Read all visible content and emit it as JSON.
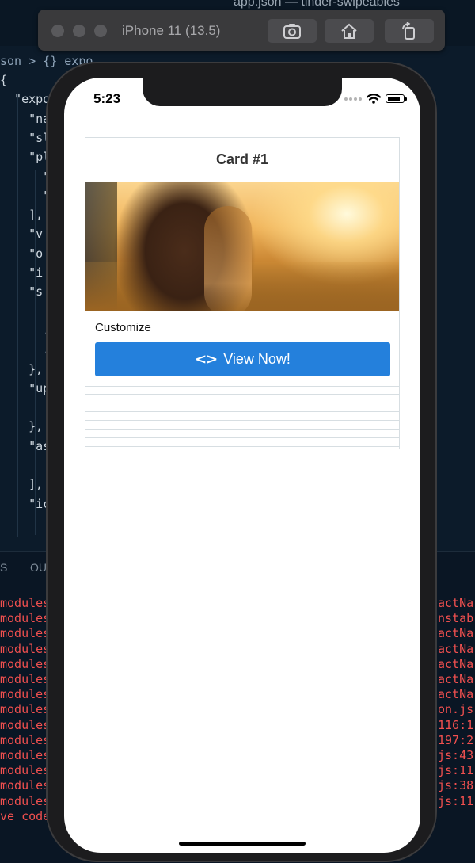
{
  "editor": {
    "title": "app.json — tinder-swipeables",
    "breadcrumb": "son > {} expo",
    "code_lines": [
      "{",
      "  \"expo",
      "    \"na",
      "    \"sl",
      "    \"pl",
      "      \"",
      "      \"",
      "    ],",
      "    \"v",
      "    \"o",
      "    \"i",
      "    \"s",
      "      '",
      "      .",
      "      .",
      "    },",
      "    \"up",
      "      '",
      "    },",
      "    \"as",
      "      '",
      "    ],",
      "    \"ic"
    ]
  },
  "terminal": {
    "tab_left": "S",
    "tab_output": "OU",
    "left_lines": [
      "modules",
      "modules",
      "modules",
      "modules",
      "modules",
      "modules",
      "modules",
      "modules",
      "modules",
      "modules",
      "modules",
      "modules",
      "modules",
      "modules",
      "ve code"
    ],
    "right_lines": [
      "actNa",
      "nstab",
      "actNa",
      "actNa",
      "actNa",
      "actNa",
      "actNa",
      "on.js",
      "116:1",
      "197:2",
      "js:43",
      "js:11",
      "js:38",
      "js:11",
      ""
    ]
  },
  "simulator": {
    "device": "iPhone 11 (13.5)",
    "buttons": [
      "screenshot-icon",
      "home-icon",
      "rotate-icon"
    ]
  },
  "status_bar": {
    "time": "5:23",
    "battery_level": 0.85
  },
  "card": {
    "title": "Card #1",
    "caption": "Customize",
    "button_label": "View Now!",
    "button_icon": "code-icon",
    "button_color": "#2480dc",
    "stack_count": 7
  }
}
